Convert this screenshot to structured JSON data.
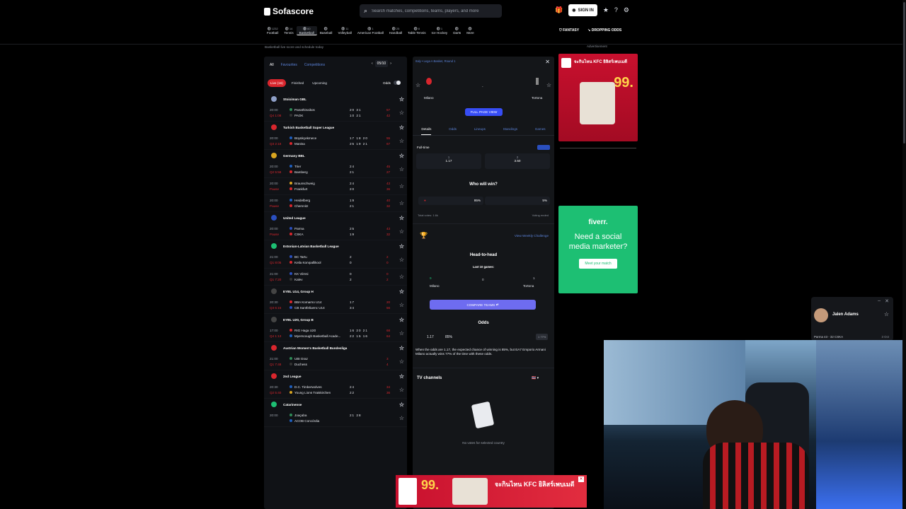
{
  "header": {
    "logo": "Sofascore",
    "search_placeholder": "Search matches, competitions, teams, players, and more",
    "signin": "SIGN IN"
  },
  "sports": [
    {
      "name": "Football",
      "count": "1232"
    },
    {
      "name": "Tennis",
      "count": "14"
    },
    {
      "name": "Basketball",
      "count": "60"
    },
    {
      "name": "Baseball",
      "count": ""
    },
    {
      "name": "Volleyball",
      "count": "11"
    },
    {
      "name": "American Football",
      "count": "1"
    },
    {
      "name": "Handball",
      "count": "25"
    },
    {
      "name": "Table Tennis",
      "count": "8"
    },
    {
      "name": "Ice Hockey",
      "count": "1"
    },
    {
      "name": "Darts",
      "count": ""
    },
    {
      "name": "More",
      "count": ""
    }
  ],
  "right_nav": {
    "fantasy": "FANTASY",
    "dropping": "DROPPING ODDS"
  },
  "subtitle": "Basketball live score and schedule today",
  "ad_label": "Advertisement",
  "left": {
    "tabs": [
      "All",
      "Favourites",
      "Competitions"
    ],
    "date": "05/10",
    "filters": [
      "Live (16)",
      "Finished",
      "Upcoming"
    ],
    "odds_label": "Odds",
    "leagues": [
      {
        "name": "Stoiximan GBL",
        "color": "#8fa0c8",
        "matches": [
          {
            "time": "20:00",
            "status": "Q4 1:08",
            "home": "Panathinaikos",
            "away": "PAOK",
            "hq": "20 31",
            "aq": "10 21",
            "hs": "57",
            "as": "42",
            "hc": "#2e8b57",
            "ac": "#333"
          }
        ]
      },
      {
        "name": "Turkish Basketball Super League",
        "color": "#d9262d",
        "matches": [
          {
            "time": "20:00",
            "status": "Q3 2:18",
            "home": "Büyükçekmece",
            "away": "Manisa",
            "hq": "17 18 20",
            "aq": "25 19 21",
            "hs": "55",
            "as": "67",
            "hc": "#1e5fbf",
            "ac": "#d9262d"
          }
        ]
      },
      {
        "name": "Germany BBL",
        "color": "#d9a520",
        "matches": [
          {
            "time": "20:00",
            "status": "Q2 5:58",
            "home": "Trier",
            "away": "Bamberg",
            "hq": "24",
            "aq": "21",
            "hs": "45",
            "as": "27",
            "hc": "#1e5fbf",
            "ac": "#d9262d"
          },
          {
            "time": "20:00",
            "status": "Pause",
            "home": "Braunschweig",
            "away": "Frankfurt",
            "hq": "24",
            "aq": "20",
            "hs": "43",
            "as": "36",
            "hc": "#d9a520",
            "ac": "#d9262d"
          },
          {
            "time": "20:00",
            "status": "Pause",
            "home": "Heidelberg",
            "away": "Chemnitz",
            "hq": "19",
            "aq": "21",
            "hs": "40",
            "as": "32",
            "hc": "#1e5fbf",
            "ac": "#d9262d"
          }
        ]
      },
      {
        "name": "United League",
        "color": "#2a4fbf",
        "matches": [
          {
            "time": "20:00",
            "status": "Pause",
            "home": "Parma",
            "away": "CSKA",
            "hq": "25",
            "aq": "19",
            "hs": "43",
            "as": "32",
            "hc": "#2a4fbf",
            "ac": "#d9262d"
          }
        ]
      },
      {
        "name": "Estonian-Latvian Basketball League",
        "color": "#1dbf73",
        "matches": [
          {
            "time": "21:00",
            "status": "Q1 8:05",
            "home": "BC Tartu",
            "away": "Keila Korvpallikool",
            "hq": "2",
            "aq": "0",
            "hs": "2",
            "as": "0",
            "hc": "#2a4fbf",
            "ac": "#d9262d"
          },
          {
            "time": "21:00",
            "status": "Q1 7:20",
            "home": "KK Viimsi",
            "away": "Kalev",
            "hq": "0",
            "aq": "2",
            "hs": "0",
            "as": "2",
            "hc": "#2a4fbf",
            "ac": "#333"
          }
        ]
      },
      {
        "name": "EYBL U14, Group H",
        "color": "#444",
        "matches": [
          {
            "time": "20:30",
            "status": "Q3 6:15",
            "home": "BBA Komarno U14",
            "away": "CB Santfeliuenc U14",
            "hq": "17",
            "aq": "34",
            "hs": "20",
            "as": "56",
            "hc": "#d9262d",
            "ac": "#2a4fbf"
          }
        ]
      },
      {
        "name": "EYBL U20, Group B",
        "color": "#444",
        "matches": [
          {
            "time": "17:00",
            "status": "Q4 1:13",
            "home": "RIG Haga U20",
            "away": "Myerscough Basketball Acade...",
            "hq": "16 20 21",
            "aq": "22 15 16",
            "hs": "68",
            "as": "64",
            "hc": "#d9262d",
            "ac": "#1e5fbf"
          }
        ]
      },
      {
        "name": "Austrian Women's Basketball Bundesliga",
        "color": "#d9262d",
        "matches": [
          {
            "time": "21:00",
            "status": "Q1 7:48",
            "home": "UBI Graz",
            "away": "Duchess",
            "hq": "",
            "aq": "",
            "hs": "3",
            "as": "4",
            "hc": "#2e8b57",
            "ac": "#333"
          }
        ]
      },
      {
        "name": "2nd League",
        "color": "#d9262d",
        "matches": [
          {
            "time": "20:30",
            "status": "Q2 5:40",
            "home": "D.C. Timberwolves",
            "away": "Young Lions Traiskirchen",
            "hq": "24",
            "aq": "22",
            "hs": "34",
            "as": "36",
            "hc": "#1e5fbf",
            "ac": "#d9a520"
          }
        ]
      },
      {
        "name": "Catarinense",
        "color": "#1dbf73",
        "matches": [
          {
            "time": "20:00",
            "status": "",
            "home": "Joaçaba",
            "away": "ACOB Concórdia",
            "hq": "21 28",
            "aq": "",
            "hs": "",
            "as": "",
            "hc": "#2e8b57",
            "ac": "#1e5fbf"
          }
        ]
      }
    ]
  },
  "middle": {
    "header": "Italy • Lega A Basket, Round 1",
    "home": "Milano",
    "away": "Tortona",
    "score": "-",
    "full_page": "FULL PAGE VIEW",
    "tabs": [
      "Details",
      "Odds",
      "Lineups",
      "Standings",
      "Games"
    ],
    "fulltime": "Full-time",
    "odd1_label": "1",
    "odd1": "1.17",
    "odd2_label": "2",
    "odd2": "3.50",
    "who_title": "Who will win?",
    "vote_home": "95%",
    "vote_away": "5%",
    "total_votes": "Total votes: 1.6k",
    "voting_ended": "Voting ended",
    "weekly": "View Weekly Challenge",
    "h2h_title": "Head-to-head",
    "h2h_sub": "Last 10 games:",
    "h2h_home": "9",
    "h2h_draw": "0",
    "h2h_away": "1",
    "compare": "COMPARE TEAMS",
    "odds_title": "Odds",
    "odds_val": "1.17",
    "odds_pct": "85%",
    "odds_badge": "1 77%",
    "odds_note": "When the odds are 1.17, the expected chance of winning is 85%, but EA7 Emporio Armani Milano actually wins 77% of the time with these odds.",
    "tv_title": "TV channels",
    "tv_empty": "No votes for selected country"
  },
  "ads": {
    "kfc_text": "จะกินไหน KFC ยิลิสร์เพบเมดี",
    "kfc_price": "99.",
    "fiverr_logo": "fiverr.",
    "fiverr_text": "Need a social media marketer?",
    "fiverr_btn": "Meet your match",
    "kfc_bottom_text": "จะกินไหน KFC ยิลิสร์เพบเมดี",
    "kfc_bottom_price": "99."
  },
  "player_card": {
    "name": "Jalen Adams",
    "match": "Parma 43 - 32 CSKA",
    "time": "3 Oct"
  }
}
